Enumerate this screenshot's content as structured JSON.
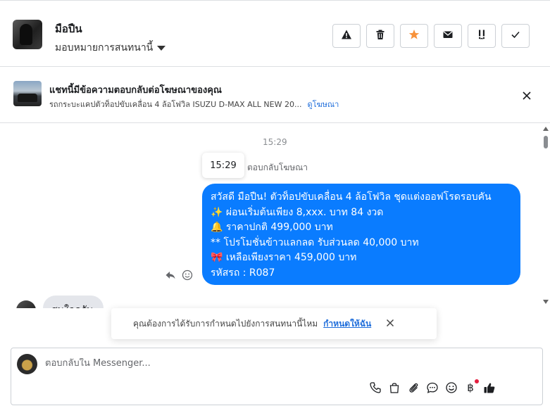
{
  "header": {
    "contact_name": "มือปืน",
    "assign_label": "มอบหมายการสนทนานี้",
    "actions": [
      "alert-icon",
      "trash-icon",
      "star-icon",
      "mail-icon",
      "spam-icon",
      "check-icon"
    ],
    "star_color": "#f7923b"
  },
  "ad": {
    "title": "แชทนี้มีข้อความตอบกลับต่อโฆษณาของคุณ",
    "subtitle": "รถกระบะแคปตัวท็อปขับเคลื่อน 4 ล้อโฟวิล ISUZU D-MAX ALL NEW 20...",
    "link": "ดูโฆษณา"
  },
  "chat": {
    "timestamp_center": "15:29",
    "timestamp_chip": "15:29",
    "reply_label": "ตอบกลับโฆษณา",
    "outgoing_message": {
      "color": "#0a7cff",
      "lines": [
        "สวัสดี มือปืน! ตัวท็อปขับเคลื่อน 4 ล้อโฟวิล ชุดแต่งออฟโรดรอบคัน",
        "✨  ผ่อนเริ่มต้นเพียง 8,xxx. บาท 84 งวด",
        "🔔 ราคาปกติ 499,000 บาท",
        "** โปรโมชั่นข้าวแลกลด รับส่วนลด 40,000 บาท",
        "🎀  เหลือเพียงราคา 459,000 บาท",
        " รหัสรถ : R087"
      ]
    },
    "incoming_message": "สนใจครับ"
  },
  "toast": {
    "text": "คุณต้องการได้รับการกำหนดไปยังการสนทนานี้ไหม",
    "link": "กำหนดให้ฉัน"
  },
  "composer": {
    "placeholder": "ตอบกลับใน Messenger...",
    "tools": [
      "phone-icon",
      "bag-icon",
      "paperclip-icon",
      "chat-bubble-icon",
      "emoji-icon",
      "baht-icon",
      "thumbs-up-icon"
    ]
  }
}
